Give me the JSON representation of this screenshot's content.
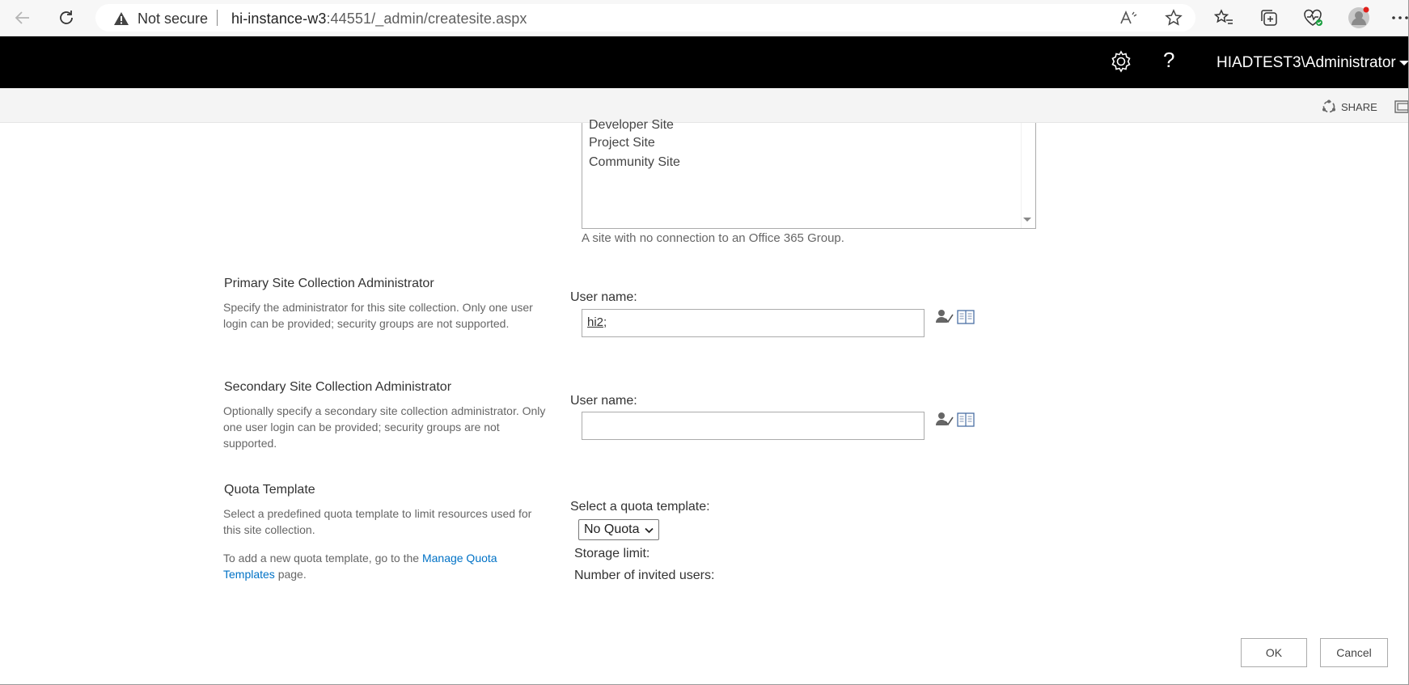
{
  "browser": {
    "security_label": "Not secure",
    "url_host": "hi-instance-w3",
    "url_rest": ":44551/_admin/createsite.aspx"
  },
  "suitebar": {
    "user": "HIADTEST3\\Administrator",
    "help_glyph": "?"
  },
  "ribbon": {
    "share_label": "SHARE"
  },
  "template_list": {
    "items": [
      "Developer Site",
      "Project Site",
      "Community Site"
    ],
    "description": "A site with no connection to an Office 365 Group."
  },
  "primary_admin": {
    "title": "Primary Site Collection Administrator",
    "description": "Specify the administrator for this site collection. Only one user login can be provided; security groups are not supported.",
    "field_label": "User name:",
    "value": "hi2",
    "value_suffix": ";"
  },
  "secondary_admin": {
    "title": "Secondary Site Collection Administrator",
    "description": "Optionally specify a secondary site collection administrator. Only one user login can be provided; security groups are not supported.",
    "field_label": "User name:",
    "value": ""
  },
  "quota": {
    "title": "Quota Template",
    "description": "Select a predefined quota template to limit resources used for this site collection.",
    "add_text_before": "To add a new quota template, go to the ",
    "link_text": "Manage Quota Templates",
    "add_text_after": " page.",
    "select_label": "Select a quota template:",
    "selected": "No Quota",
    "storage_limit_label": "Storage limit:",
    "invited_users_label": "Number of invited users:"
  },
  "actions": {
    "ok": "OK",
    "cancel": "Cancel"
  },
  "colors": {
    "suitebar": "#000000",
    "link": "#0072c6"
  }
}
